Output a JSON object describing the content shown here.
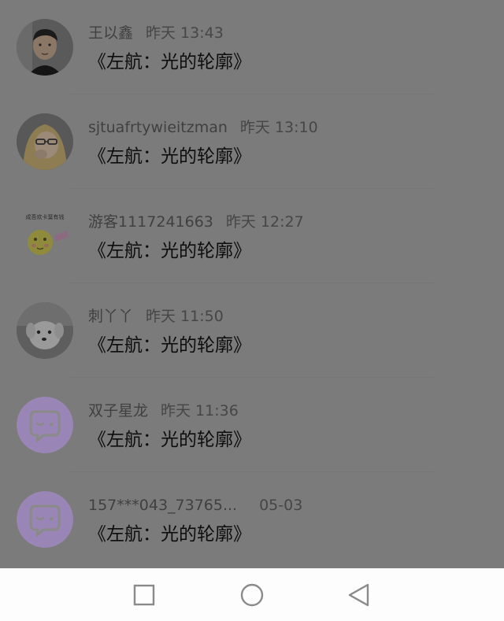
{
  "comments": [
    {
      "name": "王以鑫",
      "time": "昨天 13:43",
      "message": "《左航：光的轮廓》",
      "avatar": "boy-photo"
    },
    {
      "name": "sjtuafrtywieitzman",
      "time": "昨天 13:10",
      "message": "《左航：光的轮廓》",
      "avatar": "girl-photo"
    },
    {
      "name": "游客1117241663",
      "time": "昨天 12:27",
      "message": "《左航：光的轮廓》",
      "avatar": "sun-face-image",
      "avatar_caption": "成吾欢卡葉有钱"
    },
    {
      "name": "刺丫丫",
      "time": "昨天 11:50",
      "message": "《左航：光的轮廓》",
      "avatar": "white-dog-photo"
    },
    {
      "name": "双子星龙",
      "time": "昨天 11:36",
      "message": "《左航：光的轮廓》",
      "avatar": "default-chat-bubble"
    },
    {
      "name": "157***043_73765...",
      "time": "05-03",
      "message": "《左航：光的轮廓》",
      "avatar": "default-chat-bubble"
    }
  ],
  "navbar": {
    "recent_icon": "square-icon",
    "home_icon": "circle-icon",
    "back_icon": "triangle-back-icon"
  },
  "colors": {
    "overlay": "#7b7b7b",
    "default_avatar": "#9a86b6",
    "navbar": "#fdfdfd"
  }
}
